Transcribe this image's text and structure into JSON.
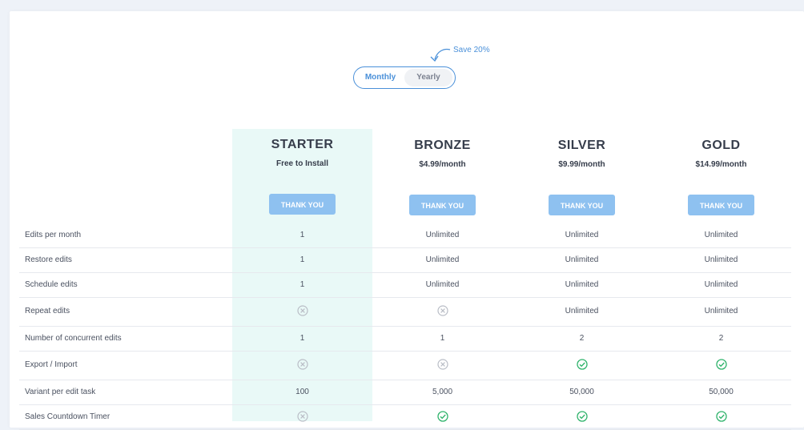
{
  "toggle": {
    "monthly": "Monthly",
    "yearly": "Yearly",
    "save_note": "Save 20%"
  },
  "plans": [
    {
      "name": "STARTER",
      "price": "Free to Install",
      "button": "THANK YOU"
    },
    {
      "name": "BRONZE",
      "price": "$4.99/month",
      "button": "THANK YOU"
    },
    {
      "name": "SILVER",
      "price": "$9.99/month",
      "button": "THANK YOU"
    },
    {
      "name": "GOLD",
      "price": "$14.99/month",
      "button": "THANK YOU"
    }
  ],
  "features": [
    {
      "label": "Edits per month",
      "values": [
        "1",
        "Unlimited",
        "Unlimited",
        "Unlimited"
      ]
    },
    {
      "label": "Restore edits",
      "values": [
        "1",
        "Unlimited",
        "Unlimited",
        "Unlimited"
      ]
    },
    {
      "label": "Schedule edits",
      "values": [
        "1",
        "Unlimited",
        "Unlimited",
        "Unlimited"
      ]
    },
    {
      "label": "Repeat edits",
      "values": [
        "x-circle-icon",
        "x-circle-icon",
        "Unlimited",
        "Unlimited"
      ]
    },
    {
      "label": "Number of concurrent edits",
      "values": [
        "1",
        "1",
        "2",
        "2"
      ]
    },
    {
      "label": "Export / Import",
      "values": [
        "x-circle-icon",
        "x-circle-icon",
        "check-circle-icon",
        "check-circle-icon"
      ]
    },
    {
      "label": "Variant per edit task",
      "values": [
        "100",
        "5,000",
        "50,000",
        "50,000"
      ]
    },
    {
      "label": "Sales Countdown Timer",
      "values": [
        "x-circle-icon",
        "check-circle-icon",
        "check-circle-icon",
        "check-circle-icon"
      ]
    }
  ],
  "colors": {
    "accent": "#4a90d9",
    "button": "#8ec1f0",
    "highlight": "#e9f9f7",
    "check": "#2fb36b",
    "cross": "#b9bdc6"
  }
}
